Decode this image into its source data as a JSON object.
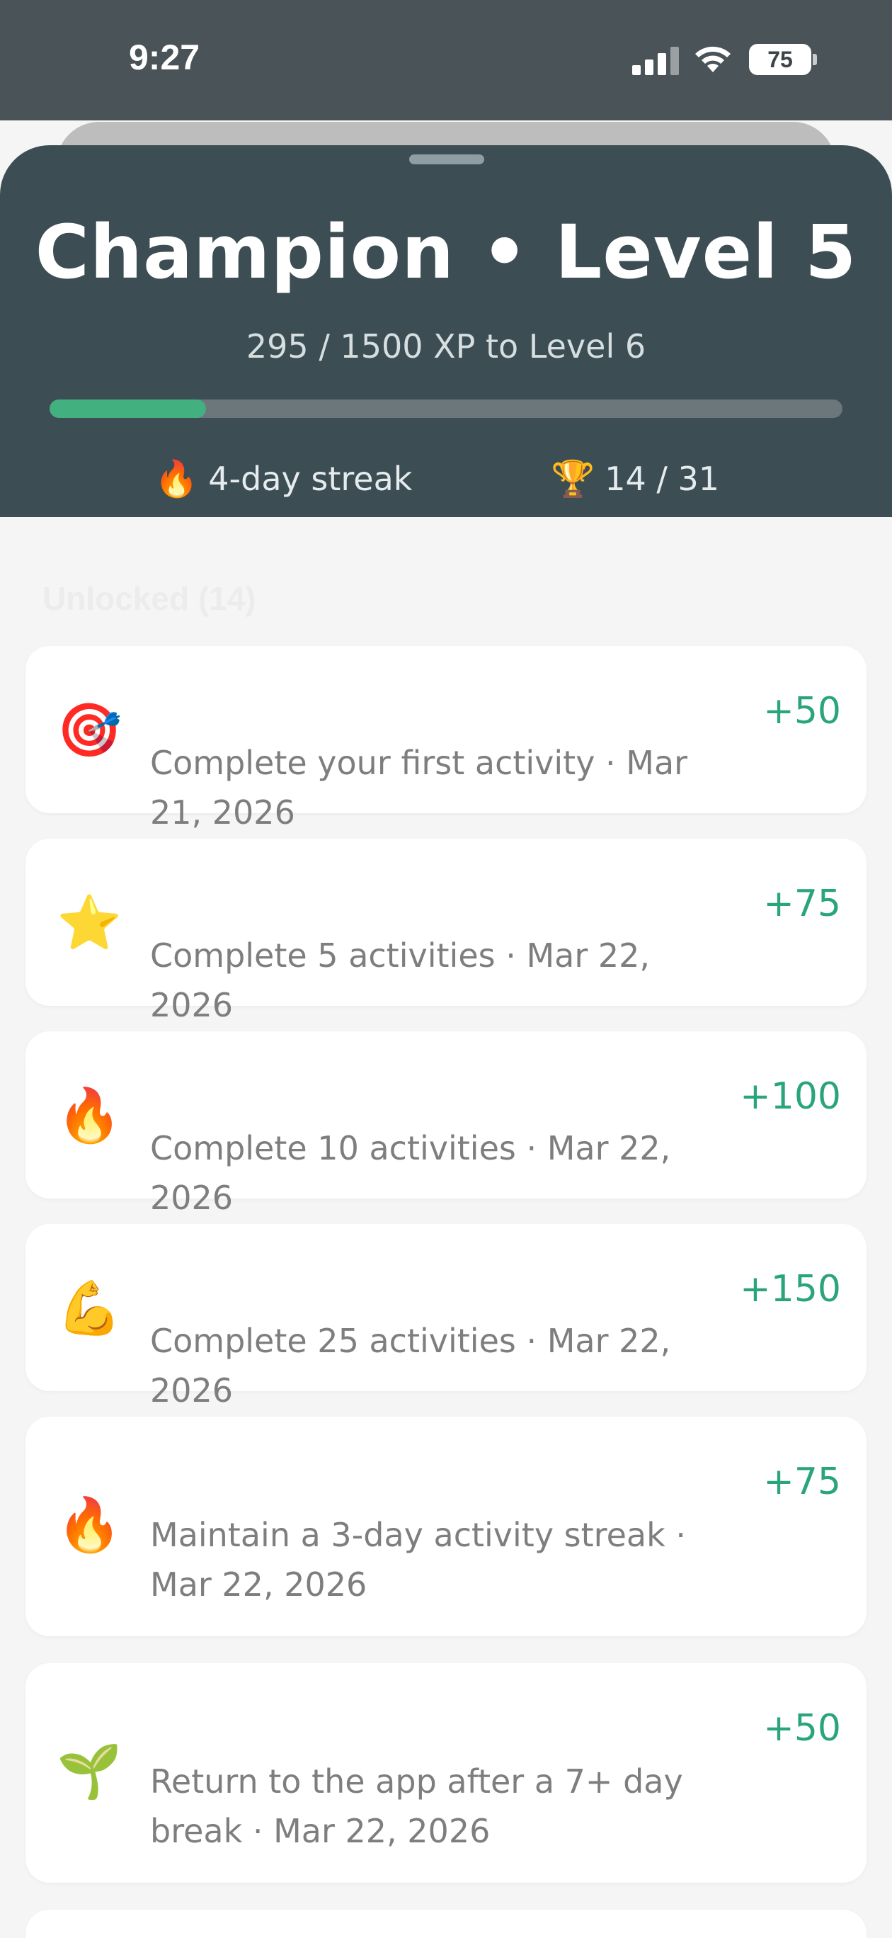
{
  "status_bar": {
    "time": "9:27",
    "battery": "75",
    "signal_icon": "cellular-signal-icon",
    "wifi_icon": "wifi-icon",
    "battery_icon": "battery-icon"
  },
  "header": {
    "title": "Champion • Level 5",
    "xp_text": "295 / 1500 XP to Level 6",
    "progress": 0.197,
    "progress_color": "#43b07f",
    "streak": {
      "emoji": "🔥",
      "label": "4-day streak"
    },
    "trophies": {
      "emoji": "🏆",
      "label": "14 / 31"
    }
  },
  "section": {
    "title": "Unlocked (14)"
  },
  "achievements": [
    {
      "icon": "🎯",
      "icon_name": "target-icon",
      "xp": "+50",
      "desc": "Complete your first activity · Mar 21, 2026"
    },
    {
      "icon": "⭐",
      "icon_name": "star-icon",
      "xp": "+75",
      "desc": "Complete 5 activities · Mar 22, 2026"
    },
    {
      "icon": "🔥",
      "icon_name": "fire-icon",
      "xp": "+100",
      "desc": "Complete 10 activities · Mar 22, 2026"
    },
    {
      "icon": "💪",
      "icon_name": "flexed-biceps-icon",
      "xp": "+150",
      "desc": "Complete 25 activities · Mar 22, 2026"
    },
    {
      "icon": "🔥",
      "icon_name": "fire-icon",
      "xp": "+75",
      "desc": "Maintain a 3-day activity streak · Mar 22, 2026"
    },
    {
      "icon": "🌱",
      "icon_name": "seedling-icon",
      "xp": "+50",
      "desc": "Return to the app after a 7+ day break · Mar 22, 2026"
    }
  ]
}
